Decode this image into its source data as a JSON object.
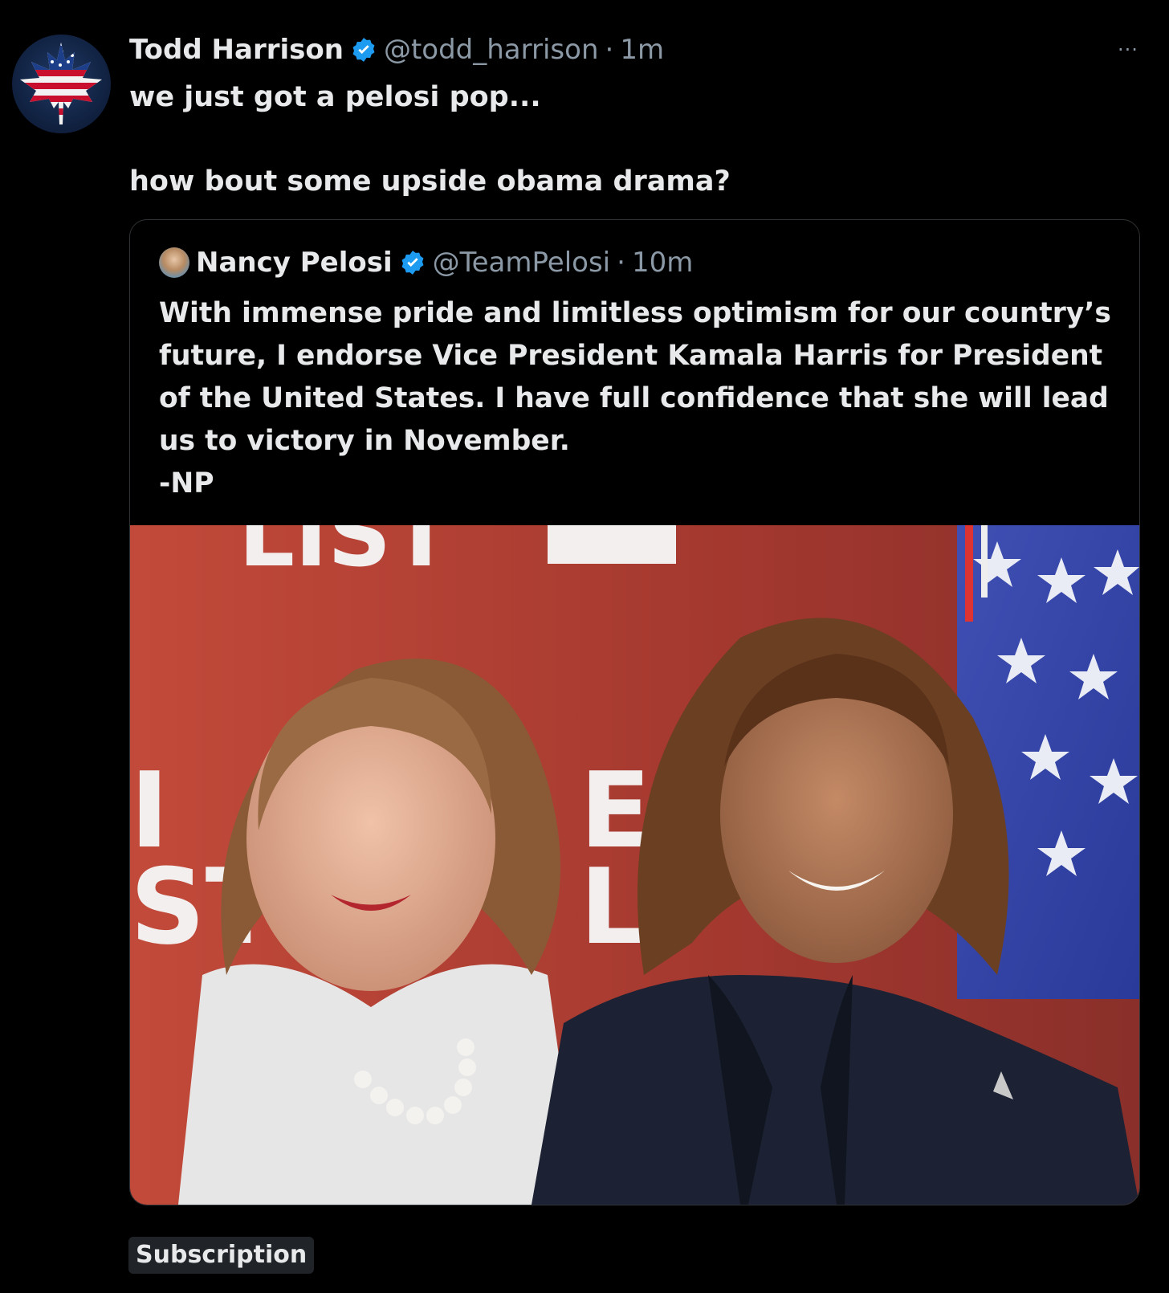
{
  "author": {
    "display_name": "Todd Harrison",
    "handle": "@todd_harrison",
    "separator": "·",
    "time": "1m",
    "verified": true
  },
  "more_label": "···",
  "tweet": {
    "line1": "we just got a pelosi pop...",
    "line2": "how bout some upside obama drama?"
  },
  "quote": {
    "display_name": "Nancy Pelosi",
    "handle": "@TeamPelosi",
    "separator": "·",
    "time": "10m",
    "verified": true,
    "text_line1": "With immense pride and limitless optimism for our country’s future, I endorse Vice President Kamala Harris for President of the United States. I have full confidence that she will lead us to victory in November.",
    "text_line2": "-NP",
    "media": {
      "backdrop_top": "LIST",
      "backdrop_mid1": "I",
      "backdrop_mid2": "EN",
      "backdrop_low1": "ST",
      "backdrop_low2": "L"
    }
  },
  "badge": {
    "label": "Subscription"
  },
  "colors": {
    "background": "#000000",
    "text": "#e7e9ea",
    "secondary": "#8b98a5",
    "verified_blue": "#1d9bf0",
    "border": "#2f3336",
    "badge_bg": "#202327"
  }
}
